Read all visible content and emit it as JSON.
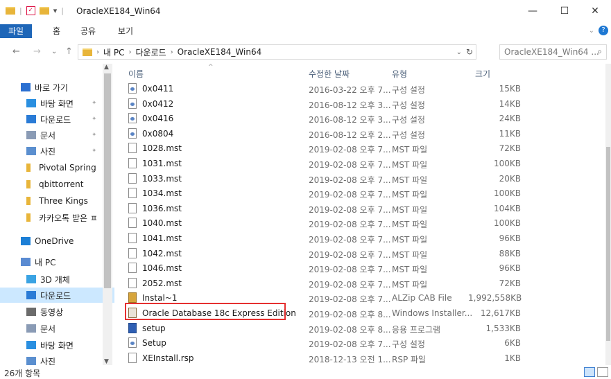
{
  "titlebar": {
    "title": "OracleXE184_Win64",
    "qa_sep": "|",
    "qa_caret": "▾",
    "controls": {
      "minimize": "—",
      "maximize": "☐",
      "close": "✕"
    }
  },
  "ribbon": {
    "tabs": [
      "파일",
      "홈",
      "공유",
      "보기"
    ],
    "collapse_glyph": "⌄",
    "help_glyph": "?"
  },
  "address": {
    "glyphs": {
      "back": "←",
      "forward": "→",
      "recent": "⌄",
      "up": "↑",
      "chevron": "›",
      "dropdown": "⌄",
      "refresh": "↻",
      "search": "⌕"
    },
    "breadcrumb": [
      "내 PC",
      "다운로드",
      "OracleXE184_Win64"
    ],
    "search_placeholder": "OracleXE184_Win64 ..."
  },
  "navpane": {
    "pin_glyph": "✦",
    "scroll_glyphs": {
      "up": "▲",
      "down": "▼"
    },
    "items": [
      {
        "label": "바로 가기",
        "icon": "star-icon"
      },
      {
        "label": "바탕 화면",
        "icon": "desktop-icon",
        "pinned": true
      },
      {
        "label": "다운로드",
        "icon": "download-icon",
        "pinned": true
      },
      {
        "label": "문서",
        "icon": "document-icon",
        "pinned": true
      },
      {
        "label": "사진",
        "icon": "picture-icon",
        "pinned": true
      },
      {
        "label": "Pivotal Spring",
        "icon": "folder-icon"
      },
      {
        "label": "qbittorrent",
        "icon": "folder-icon"
      },
      {
        "label": "Three Kings",
        "icon": "folder-icon"
      },
      {
        "label": "카카오톡 받은 ㅍ",
        "icon": "folder-icon"
      },
      {
        "label": "OneDrive",
        "icon": "cloud-icon"
      },
      {
        "label": "내 PC",
        "icon": "pc-icon"
      },
      {
        "label": "3D 개체",
        "icon": "cube-icon"
      },
      {
        "label": "다운로드",
        "icon": "download-icon",
        "selected": true
      },
      {
        "label": "동영상",
        "icon": "video-icon"
      },
      {
        "label": "문서",
        "icon": "document-icon"
      },
      {
        "label": "바탕 화면",
        "icon": "desktop-icon"
      },
      {
        "label": "사진",
        "icon": "picture-icon"
      }
    ]
  },
  "filelist": {
    "sort_glyph": "^",
    "columns": {
      "name": "이름",
      "date": "수정한 날짜",
      "type": "유형",
      "size": "크기"
    },
    "rows": [
      {
        "name": "0x0411",
        "date": "2016-03-22 오후 7...",
        "type": "구성 설정",
        "size": "15KB",
        "icon": "cfg"
      },
      {
        "name": "0x0412",
        "date": "2016-08-12 오후 3...",
        "type": "구성 설정",
        "size": "14KB",
        "icon": "cfg"
      },
      {
        "name": "0x0416",
        "date": "2016-08-12 오후 3...",
        "type": "구성 설정",
        "size": "24KB",
        "icon": "cfg"
      },
      {
        "name": "0x0804",
        "date": "2016-08-12 오후 2...",
        "type": "구성 설정",
        "size": "11KB",
        "icon": "cfg"
      },
      {
        "name": "1028.mst",
        "date": "2019-02-08 오후 7...",
        "type": "MST 파일",
        "size": "72KB",
        "icon": "file"
      },
      {
        "name": "1031.mst",
        "date": "2019-02-08 오후 7...",
        "type": "MST 파일",
        "size": "100KB",
        "icon": "file"
      },
      {
        "name": "1033.mst",
        "date": "2019-02-08 오후 7...",
        "type": "MST 파일",
        "size": "20KB",
        "icon": "file"
      },
      {
        "name": "1034.mst",
        "date": "2019-02-08 오후 7...",
        "type": "MST 파일",
        "size": "100KB",
        "icon": "file"
      },
      {
        "name": "1036.mst",
        "date": "2019-02-08 오후 7...",
        "type": "MST 파일",
        "size": "104KB",
        "icon": "file"
      },
      {
        "name": "1040.mst",
        "date": "2019-02-08 오후 7...",
        "type": "MST 파일",
        "size": "100KB",
        "icon": "file"
      },
      {
        "name": "1041.mst",
        "date": "2019-02-08 오후 7...",
        "type": "MST 파일",
        "size": "96KB",
        "icon": "file"
      },
      {
        "name": "1042.mst",
        "date": "2019-02-08 오후 7...",
        "type": "MST 파일",
        "size": "88KB",
        "icon": "file"
      },
      {
        "name": "1046.mst",
        "date": "2019-02-08 오후 7...",
        "type": "MST 파일",
        "size": "96KB",
        "icon": "file"
      },
      {
        "name": "2052.mst",
        "date": "2019-02-08 오후 7...",
        "type": "MST 파일",
        "size": "72KB",
        "icon": "file"
      },
      {
        "name": "Instal~1",
        "date": "2019-02-08 오후 7...",
        "type": "ALZip CAB File",
        "size": "1,992,558KB",
        "icon": "cab"
      },
      {
        "name": "Oracle Database 18c Express Edition",
        "date": "2019-02-08 오후 8...",
        "type": "Windows Installer...",
        "size": "12,617KB",
        "icon": "msi",
        "highlighted": true
      },
      {
        "name": "setup",
        "date": "2019-02-08 오후 8...",
        "type": "응용 프로그램",
        "size": "1,533KB",
        "icon": "exe"
      },
      {
        "name": "Setup",
        "date": "2019-02-08 오후 7...",
        "type": "구성 설정",
        "size": "6KB",
        "icon": "cfg"
      },
      {
        "name": "XEInstall.rsp",
        "date": "2018-12-13 오전 1...",
        "type": "RSP 파일",
        "size": "1KB",
        "icon": "file"
      }
    ]
  },
  "status": {
    "count": "26개 항목"
  },
  "colors": {
    "accent": "#1e66b8",
    "selection": "#cce8ff",
    "highlight_border": "#e53030"
  }
}
